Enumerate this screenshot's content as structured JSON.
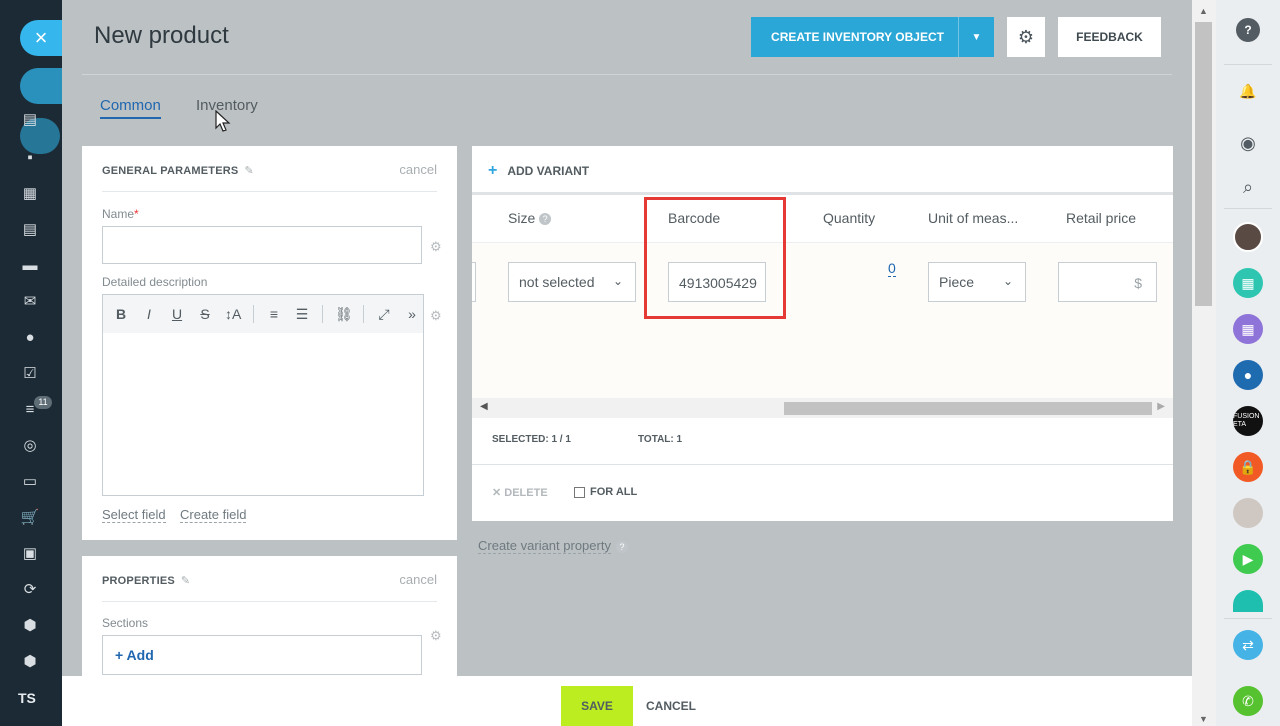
{
  "left_bar": {
    "close_symbol": "×",
    "badge": "11",
    "user_initials": "TS",
    "icons": [
      "tasks-icon",
      "chat-icon",
      "calendar-icon",
      "document-icon",
      "drive-icon",
      "mail-icon",
      "groups-icon",
      "checklist-icon",
      "filter-icon",
      "target-icon",
      "window-icon",
      "cart-icon",
      "contact-card-icon",
      "sync-icon",
      "box-icon",
      "box-alt-icon"
    ]
  },
  "header": {
    "title": "New product",
    "create_button": "CREATE INVENTORY OBJECT",
    "feedback_button": "FEEDBACK"
  },
  "tabs": [
    {
      "label": "Common",
      "active": true
    },
    {
      "label": "Inventory",
      "active": false
    }
  ],
  "general": {
    "heading": "GENERAL PARAMETERS",
    "cancel": "cancel",
    "name_label": "Name",
    "required_mark": "*",
    "description_label": "Detailed description",
    "toolbar": [
      "B",
      "I",
      "U",
      "S",
      "↕A",
      "≡",
      "☰",
      "⛓",
      "⤢",
      "»"
    ],
    "select_field": "Select field",
    "create_field": "Create field"
  },
  "properties": {
    "heading": "PROPERTIES",
    "cancel": "cancel",
    "sections_label": "Sections",
    "add": "+ Add"
  },
  "variants": {
    "add_variant": "ADD VARIANT",
    "columns": {
      "size": "Size",
      "barcode": "Barcode",
      "quantity": "Quantity",
      "unit": "Unit of meas...",
      "retail_price": "Retail price"
    },
    "row": {
      "size": "not selected",
      "barcode": "4913005429",
      "quantity": "0",
      "unit": "Piece",
      "currency": "$"
    },
    "selected_label": "SELECTED:",
    "selected_value": "1 / 1",
    "total_label": "TOTAL:",
    "total_value": "1",
    "delete": "DELETE",
    "for_all": "FOR ALL",
    "create_property": "Create variant property"
  },
  "footer": {
    "save": "SAVE",
    "cancel": "CANCEL"
  },
  "right_bar": {
    "avatar_text": "FUSION ETA",
    "colors": {
      "calendar_green": "#2fc6b1",
      "calendar_purple": "#8e73d9",
      "groups_blue": "#1f6bb0",
      "lock_orange": "#f15a24",
      "video_green": "#3fcb4f",
      "video_teal": "#1fbfb0",
      "phone_blue": "#46b3e6",
      "call_green": "#56c22f"
    }
  }
}
